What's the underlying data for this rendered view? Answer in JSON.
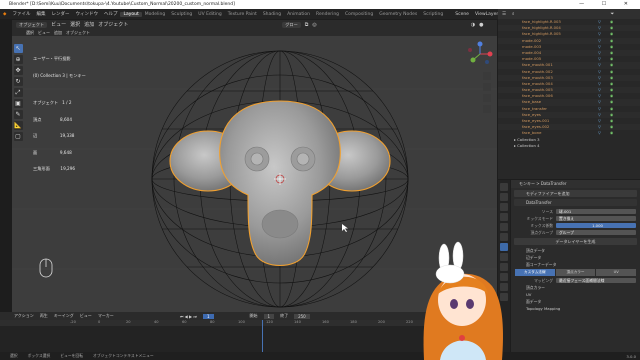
{
  "titlebar": {
    "title": "Blender* [D:\\Semi\\Kuu\\Documents\\tokupa-\\4.Youtube\\Custom_Normal\\20200_custom_normal.blend]",
    "controls": "— ☐ ✕"
  },
  "menu": {
    "items": [
      "ファイル",
      "編集",
      "レンダー",
      "ウィンドウ",
      "ヘルプ"
    ],
    "workspaces": [
      "Layout",
      "Modeling",
      "Sculpting",
      "UV Editing",
      "Texture Paint",
      "Shading",
      "Animation",
      "Rendering",
      "Compositing",
      "Geometry Nodes",
      "Scripting"
    ],
    "active_workspace": "Layout",
    "scene": "Scene",
    "view_layer": "ViewLayer"
  },
  "viewport": {
    "mode": "オブジェクト",
    "menus": [
      "ビュー",
      "選択",
      "追加",
      "オブジェクト"
    ],
    "orientation": "グロー",
    "header2": [
      "選択",
      "ビュー",
      "追加",
      "オブジェクト"
    ],
    "stats": [
      "ユーザー・平行投影",
      "(0) Collection 3 | モンキー",
      "",
      "オブジェクト   1 / 2",
      "頂点              8,604",
      "辺                 19,338",
      "面                 9,648",
      "三角形面        19,296"
    ]
  },
  "outliner": {
    "rows": [
      "face_highlight.R.003",
      "face_highlight.R.004",
      "face_highlight.R.005",
      "mode.002",
      "mode.003",
      "mode.004",
      "mode.005",
      "face_mouth.001",
      "face_mouth.002",
      "face_mouth.003",
      "face_mouth.004",
      "face_mouth.005",
      "face_mouth.006",
      "face_base",
      "face_transfer",
      "face_eyes",
      "face_eyes.001",
      "face_eyes.002",
      "face_bone"
    ],
    "collections": [
      "Collection 3",
      "Collection 4"
    ]
  },
  "properties": {
    "header": "モンキー  >  DataTransfer",
    "modifier": "DataTransfer",
    "add_modifier": "モディファイアーを追加",
    "source_label": "ソース",
    "source_value": "球.001",
    "mix_mode_label": "ミックスモード",
    "mix_mode_value": "置き換え",
    "mix_factor_label": "ミックス係数",
    "mix_factor_value": "1.000",
    "vertex_group_label": "頂点グループ",
    "vertex_group_value": "グループ",
    "generate_layers": "データレイヤーを生成",
    "vertex_data": "頂点データ",
    "edge_data": "辺データ",
    "face_corner_data": "面コーナーデータ",
    "corner_tabs": [
      "カスタム法線",
      "頂点カラー",
      "UV"
    ],
    "mapping_label": "マッピング",
    "mapping_value": "最近接フェース面補間法線",
    "vertex_color": "頂点カラー",
    "uv": "UV",
    "face_data": "面データ",
    "topology": "Topology Mapping"
  },
  "timeline": {
    "menus": [
      "アクション",
      "再生",
      "キーイング",
      "ビュー",
      "マーカー"
    ],
    "start_label": "開始",
    "start": "1",
    "end_label": "終了",
    "end": "250",
    "current": "1",
    "ticks": [
      "-20",
      "0",
      "20",
      "40",
      "60",
      "80",
      "100",
      "120",
      "140",
      "160",
      "180",
      "200",
      "220",
      "240",
      "260"
    ]
  },
  "status": {
    "items": [
      "選択",
      "ボックス選択",
      "ビューを回転",
      "オブジェクトコンテキストメニュー"
    ],
    "version": "3.0.0"
  },
  "colors": {
    "viewport_bg": "#3d3d3d",
    "selection_outline": "#f0a030",
    "accent": "#4772b3",
    "outliner_object": "#d39a60"
  }
}
